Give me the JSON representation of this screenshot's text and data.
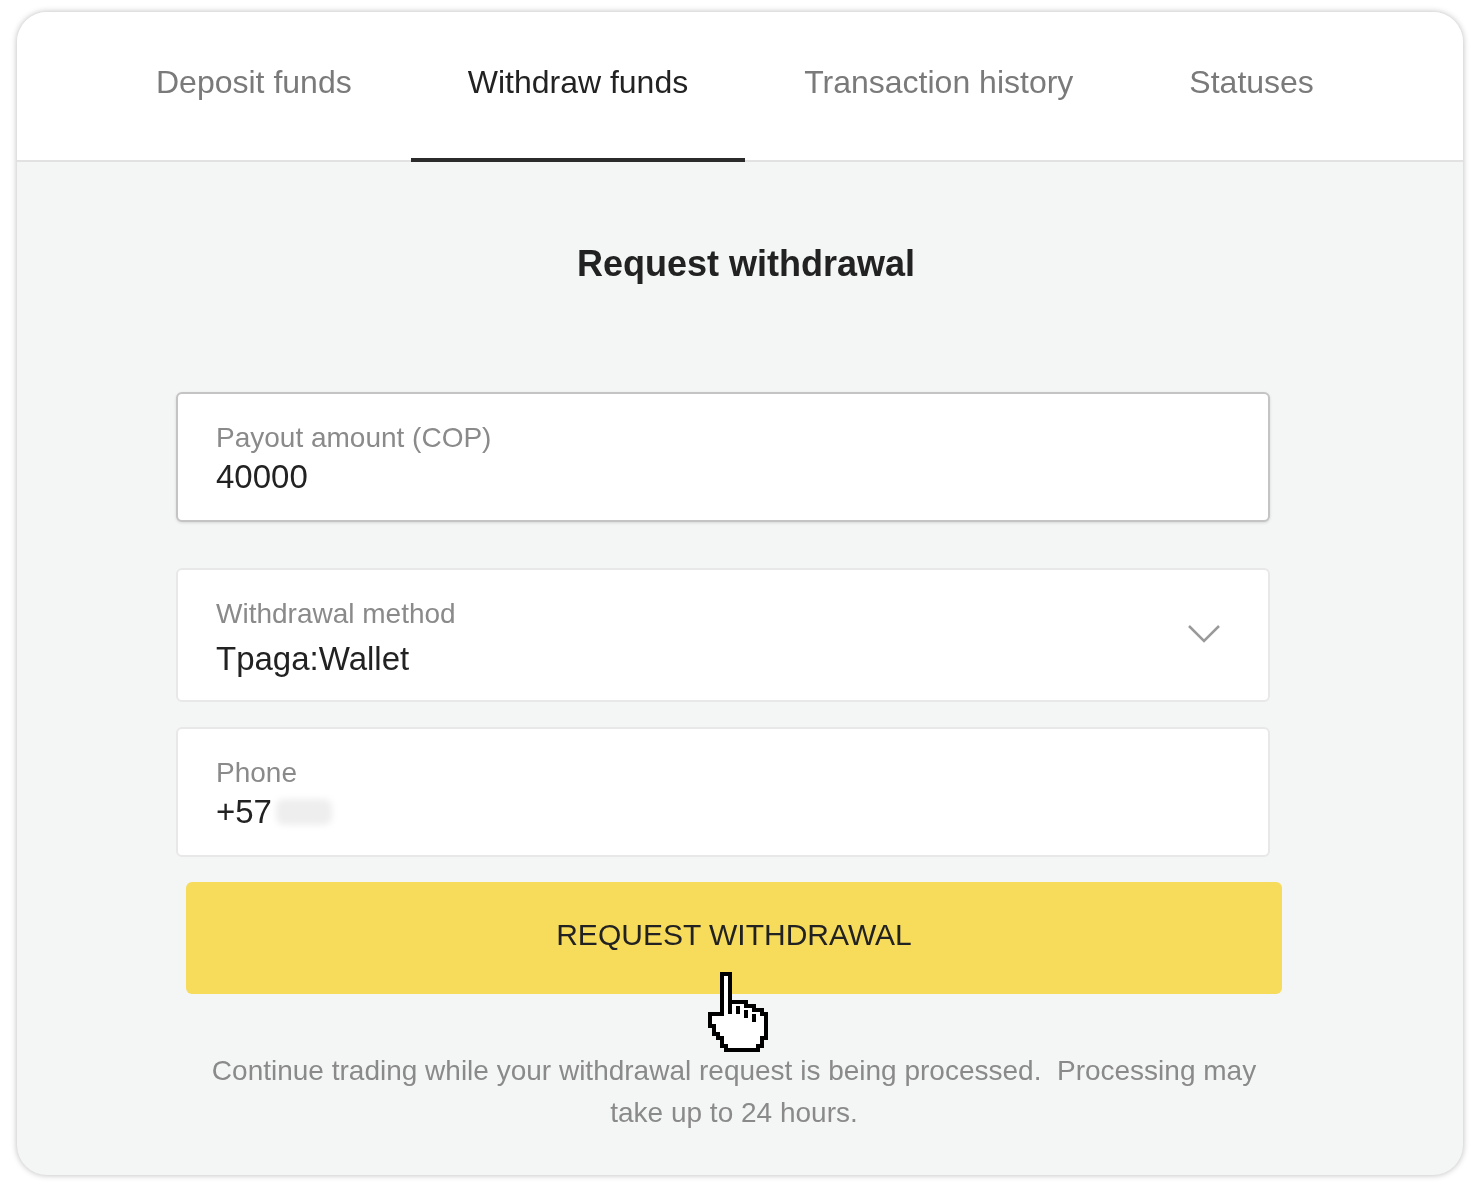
{
  "tabs": [
    {
      "label": "Deposit funds",
      "selected": false
    },
    {
      "label": "Withdraw funds",
      "selected": true
    },
    {
      "label": "Transaction history",
      "selected": false
    },
    {
      "label": "Statuses",
      "selected": false
    }
  ],
  "form": {
    "title": "Request withdrawal",
    "fields": [
      {
        "kind": "input",
        "label": "Payout amount (COP)",
        "value": "40000",
        "focused": true,
        "redacted": false
      },
      {
        "kind": "select",
        "label": "Withdrawal method",
        "value": "Tpaga:Wallet",
        "focused": false,
        "redacted": false
      },
      {
        "kind": "input",
        "label": "Phone",
        "value": "+57",
        "focused": false,
        "redacted": true
      }
    ],
    "submit_button": "REQUEST WITHDRAWAL",
    "note": "Continue trading while your withdrawal request is being processed.  Processing may take up to 24 hours."
  }
}
